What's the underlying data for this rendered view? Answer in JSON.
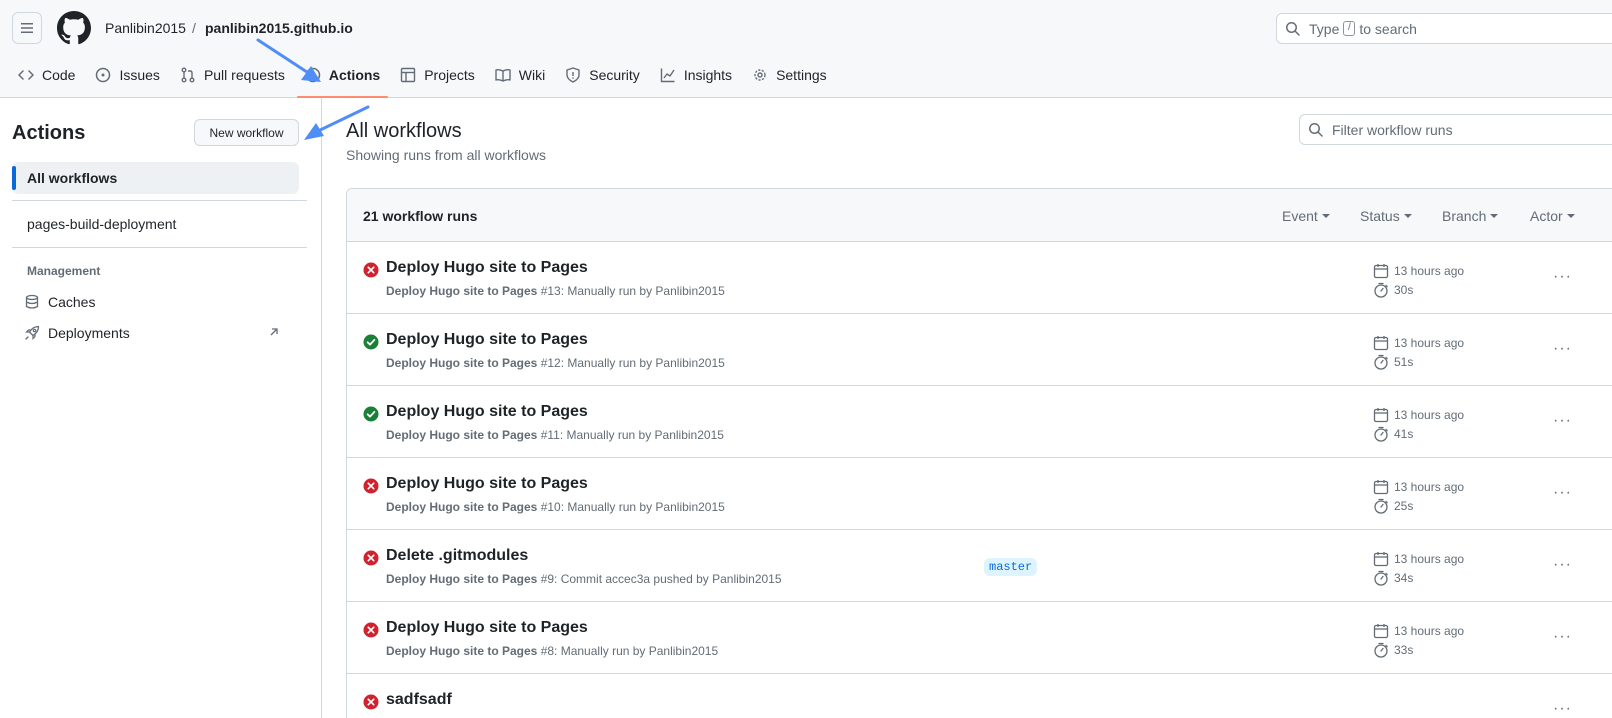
{
  "header": {
    "owner": "Panlibin2015",
    "separator": "/",
    "repo": "panlibin2015.github.io",
    "search_prefix": "Type",
    "search_key": "/",
    "search_suffix": "to search"
  },
  "tabs": [
    {
      "label": "Code",
      "icon": "code-icon"
    },
    {
      "label": "Issues",
      "icon": "issue-icon"
    },
    {
      "label": "Pull requests",
      "icon": "pull-request-icon"
    },
    {
      "label": "Actions",
      "icon": "play-icon",
      "active": true
    },
    {
      "label": "Projects",
      "icon": "table-icon"
    },
    {
      "label": "Wiki",
      "icon": "book-icon"
    },
    {
      "label": "Security",
      "icon": "shield-icon"
    },
    {
      "label": "Insights",
      "icon": "graph-icon"
    },
    {
      "label": "Settings",
      "icon": "gear-icon"
    }
  ],
  "sidebar": {
    "title": "Actions",
    "new_workflow": "New workflow",
    "all_workflows": "All workflows",
    "workflow": "pages-build-deployment",
    "management_label": "Management",
    "caches": "Caches",
    "deployments": "Deployments"
  },
  "main": {
    "title": "All workflows",
    "subtitle": "Showing runs from all workflows",
    "filter_placeholder": "Filter workflow runs",
    "count": "21 workflow runs",
    "filters": {
      "event": "Event",
      "status": "Status",
      "branch": "Branch",
      "actor": "Actor"
    }
  },
  "runs": [
    {
      "status": "failure",
      "title": "Deploy Hugo site to Pages",
      "workflow": "Deploy Hugo site to Pages",
      "number": " #13: Manually run by Panlibin2015",
      "branch": "",
      "time": "13 hours ago",
      "duration": "30s"
    },
    {
      "status": "success",
      "title": "Deploy Hugo site to Pages",
      "workflow": "Deploy Hugo site to Pages",
      "number": " #12: Manually run by Panlibin2015",
      "branch": "",
      "time": "13 hours ago",
      "duration": "51s"
    },
    {
      "status": "success",
      "title": "Deploy Hugo site to Pages",
      "workflow": "Deploy Hugo site to Pages",
      "number": " #11: Manually run by Panlibin2015",
      "branch": "",
      "time": "13 hours ago",
      "duration": "41s"
    },
    {
      "status": "failure",
      "title": "Deploy Hugo site to Pages",
      "workflow": "Deploy Hugo site to Pages",
      "number": " #10: Manually run by Panlibin2015",
      "branch": "",
      "time": "13 hours ago",
      "duration": "25s"
    },
    {
      "status": "failure",
      "title": "Delete .gitmodules",
      "workflow": "Deploy Hugo site to Pages",
      "number": " #9: Commit accec3a pushed by Panlibin2015",
      "branch": "master",
      "time": "13 hours ago",
      "duration": "34s"
    },
    {
      "status": "failure",
      "title": "Deploy Hugo site to Pages",
      "workflow": "Deploy Hugo site to Pages",
      "number": " #8: Manually run by Panlibin2015",
      "branch": "",
      "time": "13 hours ago",
      "duration": "33s"
    },
    {
      "status": "failure",
      "title": "sadfsadf",
      "workflow": "",
      "number": "",
      "branch": "",
      "time": "",
      "duration": ""
    }
  ],
  "colors": {
    "success": "#1a7f37",
    "failure": "#cf222e",
    "accent": "#0969da",
    "tab_underline": "#fd8c73",
    "annotation_arrow": "#4f8ef7"
  }
}
